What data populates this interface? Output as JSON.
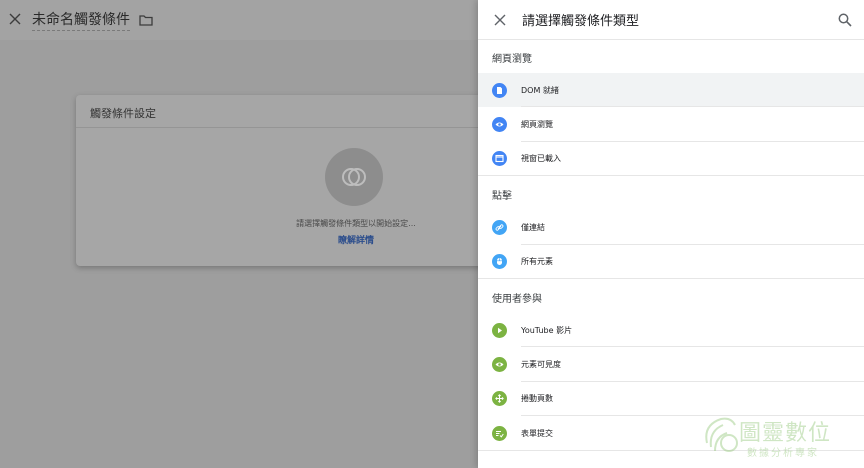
{
  "app": {
    "title": "未命名觸發條件",
    "close_glyph": "✕"
  },
  "card": {
    "title": "觸發條件設定",
    "hint": "請選擇觸發條件類型以開始設定...",
    "link": "瞭解詳情"
  },
  "panel": {
    "title": "請選擇觸發條件類型",
    "sections": [
      {
        "label": "網頁瀏覽",
        "items": [
          {
            "label": "DOM 就緒",
            "icon": "document-icon",
            "color": "#4285f4",
            "active": true
          },
          {
            "label": "網頁瀏覽",
            "icon": "eye-icon",
            "color": "#4285f4",
            "active": false
          },
          {
            "label": "視窗已載入",
            "icon": "window-icon",
            "color": "#4285f4",
            "active": false
          }
        ]
      },
      {
        "label": "點擊",
        "items": [
          {
            "label": "僅連結",
            "icon": "link-icon",
            "color": "#42a5f5",
            "active": false
          },
          {
            "label": "所有元素",
            "icon": "mouse-icon",
            "color": "#42a5f5",
            "active": false
          }
        ]
      },
      {
        "label": "使用者參與",
        "items": [
          {
            "label": "YouTube 影片",
            "icon": "play-icon",
            "color": "#7cb342",
            "active": false
          },
          {
            "label": "元素可見度",
            "icon": "eye-icon",
            "color": "#7cb342",
            "active": false
          },
          {
            "label": "捲動頁數",
            "icon": "move-icon",
            "color": "#7cb342",
            "active": false
          },
          {
            "label": "表單提交",
            "icon": "form-icon",
            "color": "#7cb342",
            "active": false
          }
        ]
      }
    ]
  },
  "watermark": {
    "name": "圖靈數位",
    "tagline": "數據分析專家"
  }
}
